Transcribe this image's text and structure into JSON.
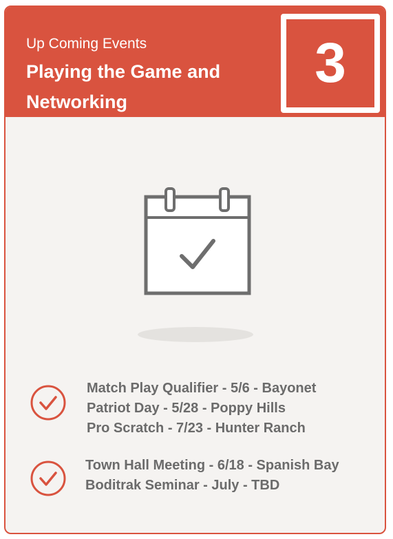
{
  "header": {
    "subtitle": "Up Coming Events",
    "title": "Playing the Game and Networking",
    "number": "3"
  },
  "icons": {
    "calendar": "calendar-check-icon",
    "bullet": "check-circle-icon"
  },
  "colors": {
    "accent": "#d9533f",
    "text": "#6b6b6b",
    "background": "#f5f3f1"
  },
  "events": {
    "group1": [
      "Match Play Qualifier - 5/6 - Bayonet",
      "Patriot Day - 5/28 - Poppy Hills",
      "Pro Scratch - 7/23 - Hunter Ranch"
    ],
    "group2": [
      "Town Hall Meeting - 6/18 - Spanish Bay",
      "Boditrak Seminar - July - TBD"
    ]
  }
}
